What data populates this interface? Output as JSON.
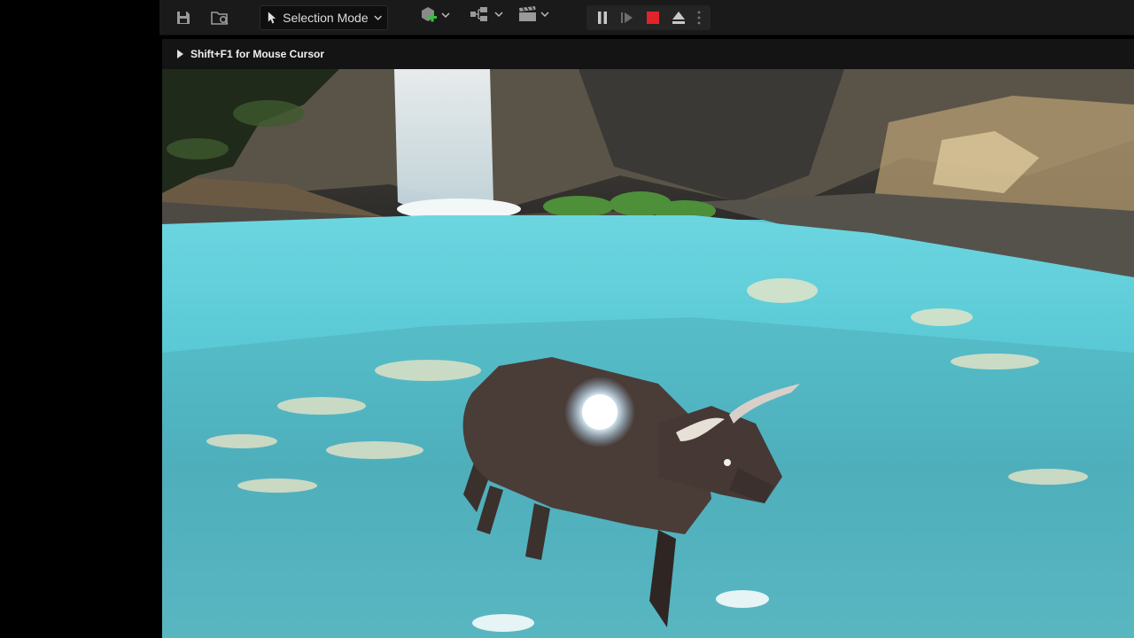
{
  "toolbar": {
    "save_icon": "save-icon",
    "browse_icon": "content-browser-icon",
    "mode_label": "Selection Mode",
    "add_icon": "add-actor-icon",
    "blueprint_icon": "blueprint-icon",
    "cinematics_icon": "clapperboard-icon",
    "play_controls": [
      "pause-icon",
      "step-forward-icon",
      "stop-icon",
      "eject-icon",
      "more-options-icon"
    ]
  },
  "viewport": {
    "hint_text": "Shift+F1 for Mouse Cursor",
    "scene": "bull-standing-in-waterfall-pool"
  },
  "colors": {
    "accent": "#2a7ee6",
    "stop_red": "#e0242a",
    "add_green": "#3dbb4a",
    "water": "#5cc6d2"
  }
}
